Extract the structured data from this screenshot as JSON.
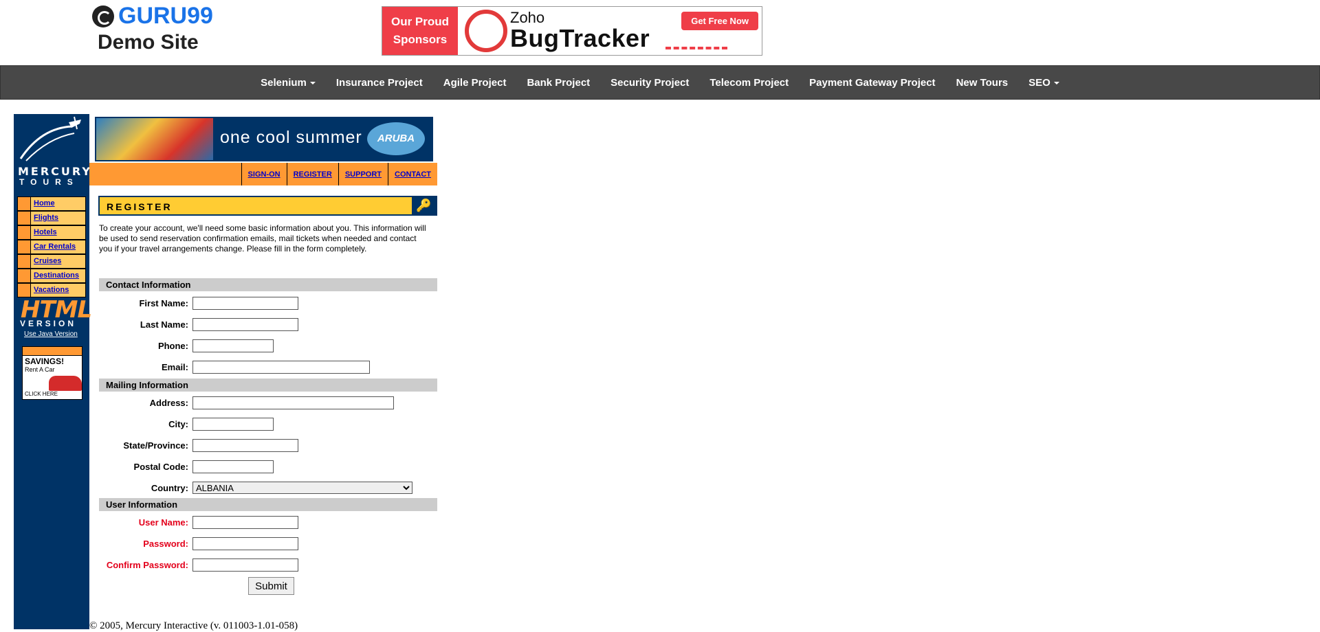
{
  "header": {
    "logo_name": "GURU99",
    "logo_sub": "Demo Site",
    "sponsor_label_1": "Our Proud",
    "sponsor_label_2": "Sponsors",
    "sponsor_brand_1": "Zoho",
    "sponsor_brand_2": "BugTracker",
    "sponsor_cta": "Get Free Now"
  },
  "nav": {
    "items": [
      "Selenium",
      "Insurance Project",
      "Agile Project",
      "Bank Project",
      "Security Project",
      "Telecom Project",
      "Payment Gateway Project",
      "New Tours",
      "SEO"
    ]
  },
  "mercury": {
    "logo_1": "MERCURY",
    "logo_2": "TOURS",
    "banner_text": "one cool summer",
    "banner_brand": "ARUBA",
    "top_menu": [
      "SIGN-ON",
      "REGISTER",
      "SUPPORT",
      "CONTACT"
    ],
    "side_menu": [
      "Home",
      "Flights",
      "Hotels",
      "Car Rentals",
      "Cruises",
      "Destinations",
      "Vacations"
    ],
    "html_version_1": "HTML",
    "html_version_2": "VERSION",
    "java_link": "Use Java Version",
    "ad_title": "SAVINGS!",
    "ad_sub": "Rent A Car",
    "ad_click": "CLICK HERE"
  },
  "register": {
    "title": "REGISTER",
    "intro": "To create your account, we'll need some basic information about you. This information will be used to send reservation confirmation emails, mail tickets when needed and contact you if your travel arrangements change. Please fill in the form completely.",
    "section_contact": "Contact Information",
    "section_mailing": "Mailing Information",
    "section_user": "User Information",
    "labels": {
      "first_name": "First Name:",
      "last_name": "Last Name:",
      "phone": "Phone:",
      "email": "Email:",
      "address": "Address:",
      "city": "City:",
      "state": "State/Province:",
      "postal": "Postal Code:",
      "country": "Country:",
      "username": "User Name:",
      "password": "Password:",
      "confirm_password": "Confirm Password:"
    },
    "country_selected": "ALBANIA",
    "submit": "Submit"
  },
  "footer": {
    "text": "© 2005, Mercury Interactive (v. 011003-1.01-058)"
  },
  "colors": {
    "nav_bg": "#484848",
    "mercury_blue": "#003366",
    "orange": "#ff9933",
    "yellow": "#ffcc33",
    "required_red": "#e3001b"
  }
}
